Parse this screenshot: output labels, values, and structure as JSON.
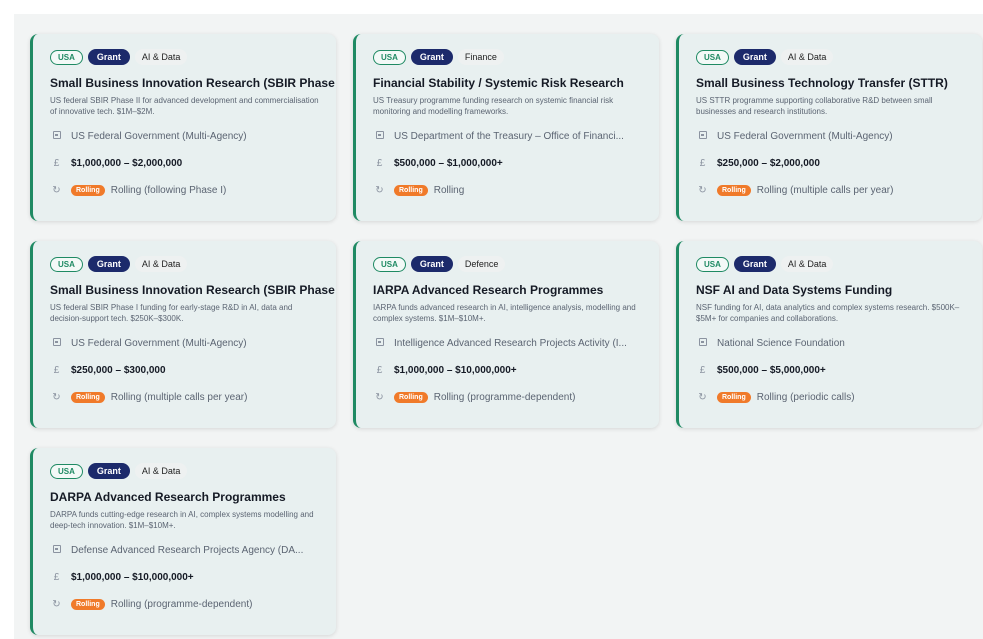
{
  "icons": {
    "agency": "building-icon",
    "amount": "pound-icon",
    "deadline": "refresh-icon"
  },
  "colors": {
    "accent_border": "#1f8a63",
    "grant_badge": "#1c2a6b",
    "rolling_badge": "#f07a2a",
    "card_bg": "#e8f0f0"
  },
  "cards": [
    {
      "country": "USA",
      "type": "Grant",
      "category": "AI & Data",
      "title": "Small Business Innovation Research (SBIR Phase II)",
      "description": "US federal SBIR Phase II for advanced development and commercialisation of innovative tech. $1M–$2M.",
      "agency": "US Federal Government (Multi-Agency)",
      "amount": "$1,000,000 – $2,000,000",
      "status": "Rolling",
      "deadline": "Rolling (following Phase I)"
    },
    {
      "country": "USA",
      "type": "Grant",
      "category": "Finance",
      "title": "Financial Stability / Systemic Risk Research",
      "description": "US Treasury programme funding research on systemic financial risk monitoring and modelling frameworks.",
      "agency": "US Department of the Treasury – Office of Financi...",
      "amount": "$500,000 – $1,000,000+",
      "status": "Rolling",
      "deadline": "Rolling"
    },
    {
      "country": "USA",
      "type": "Grant",
      "category": "AI & Data",
      "title": "Small Business Technology Transfer (STTR)",
      "description": "US STTR programme supporting collaborative R&D between small businesses and research institutions.",
      "agency": "US Federal Government (Multi-Agency)",
      "amount": "$250,000 – $2,000,000",
      "status": "Rolling",
      "deadline": "Rolling (multiple calls per year)"
    },
    {
      "country": "USA",
      "type": "Grant",
      "category": "AI & Data",
      "title": "Small Business Innovation Research (SBIR Phase I)",
      "description": "US federal SBIR Phase I funding for early-stage R&D in AI, data and decision-support tech. $250K–$300K.",
      "agency": "US Federal Government (Multi-Agency)",
      "amount": "$250,000 – $300,000",
      "status": "Rolling",
      "deadline": "Rolling (multiple calls per year)"
    },
    {
      "country": "USA",
      "type": "Grant",
      "category": "Defence",
      "title": "IARPA Advanced Research Programmes",
      "description": "IARPA funds advanced research in AI, intelligence analysis, modelling and complex systems. $1M–$10M+.",
      "agency": "Intelligence Advanced Research Projects Activity (I...",
      "amount": "$1,000,000 – $10,000,000+",
      "status": "Rolling",
      "deadline": "Rolling (programme-dependent)"
    },
    {
      "country": "USA",
      "type": "Grant",
      "category": "AI & Data",
      "title": "NSF AI and Data Systems Funding",
      "description": "NSF funding for AI, data analytics and complex systems research. $500K–$5M+ for companies and collaborations.",
      "agency": "National Science Foundation",
      "amount": "$500,000 – $5,000,000+",
      "status": "Rolling",
      "deadline": "Rolling (periodic calls)"
    },
    {
      "country": "USA",
      "type": "Grant",
      "category": "AI & Data",
      "title": "DARPA Advanced Research Programmes",
      "description": "DARPA funds cutting-edge research in AI, complex systems modelling and deep-tech innovation. $1M–$10M+.",
      "agency": "Defense Advanced Research Projects Agency (DA...",
      "amount": "$1,000,000 – $10,000,000+",
      "status": "Rolling",
      "deadline": "Rolling (programme-dependent)"
    }
  ]
}
